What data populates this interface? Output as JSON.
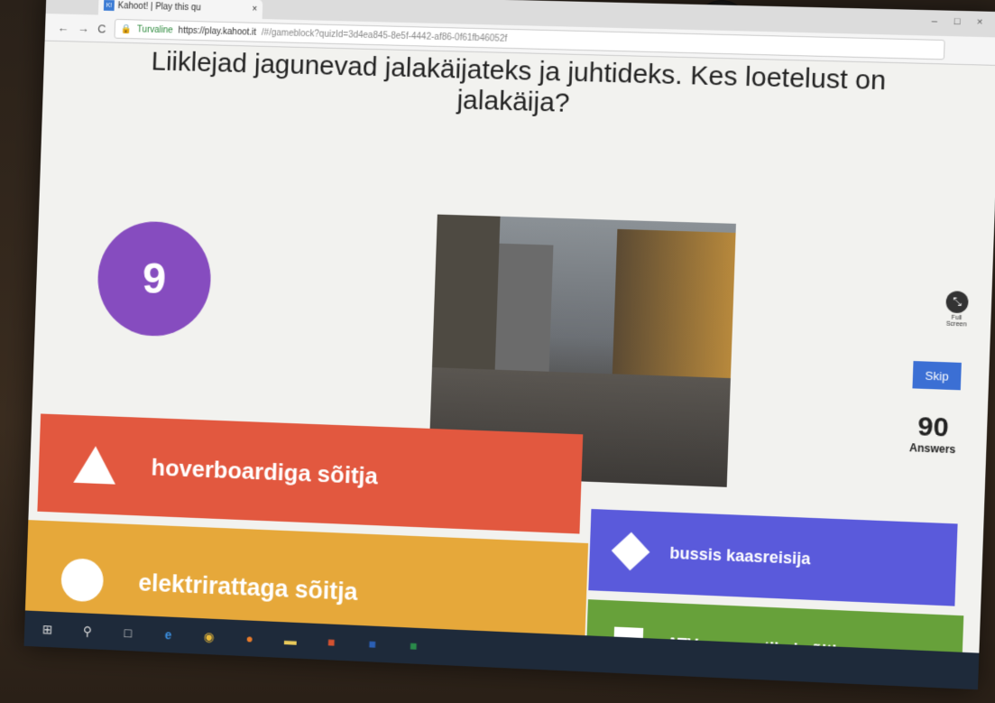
{
  "browser": {
    "tab_title": "Kahoot! | Play this qu",
    "tab_favicon": "K!",
    "tab_close": "×",
    "url_secure_label": "Turvaline",
    "url_host": "https://play.kahoot.it",
    "url_path": "/#/gameblock?quizId=3d4ea845-8e5f-4442-af86-0f61fb46052f",
    "nav_back": "←",
    "nav_forward": "→",
    "nav_reload": "C",
    "win_minimize": "–",
    "win_maximize": "□",
    "win_close": "×"
  },
  "game": {
    "question": "Liiklejad jagunevad jalakäijateks ja juhtideks. Kes loetelust on jalakäija?",
    "timer": "9",
    "fullscreen_label": "Full Screen",
    "skip_label": "Skip",
    "answers_count": "90",
    "answers_label": "Answers",
    "answers": [
      {
        "shape": "triangle",
        "text": "hoverboardiga sõitja",
        "color": "#e2583f"
      },
      {
        "shape": "diamond",
        "text": "bussis kaasreisija",
        "color": "#5a5adb"
      },
      {
        "shape": "circle",
        "text": "elektrirattaga sõitja",
        "color": "#e6a83a"
      },
      {
        "shape": "square",
        "text": "ATVga maastikul sõitja",
        "color": "#67a13a"
      }
    ]
  },
  "taskbar": {
    "icons": [
      "windows-start-icon",
      "search-icon",
      "task-view-icon",
      "edge-icon",
      "chrome-icon",
      "firefox-icon",
      "file-explorer-icon",
      "powerpoint-icon",
      "word-icon",
      "excel-icon"
    ]
  },
  "colors": {
    "timer": "#864cbf",
    "skip": "#3b6fd4"
  }
}
